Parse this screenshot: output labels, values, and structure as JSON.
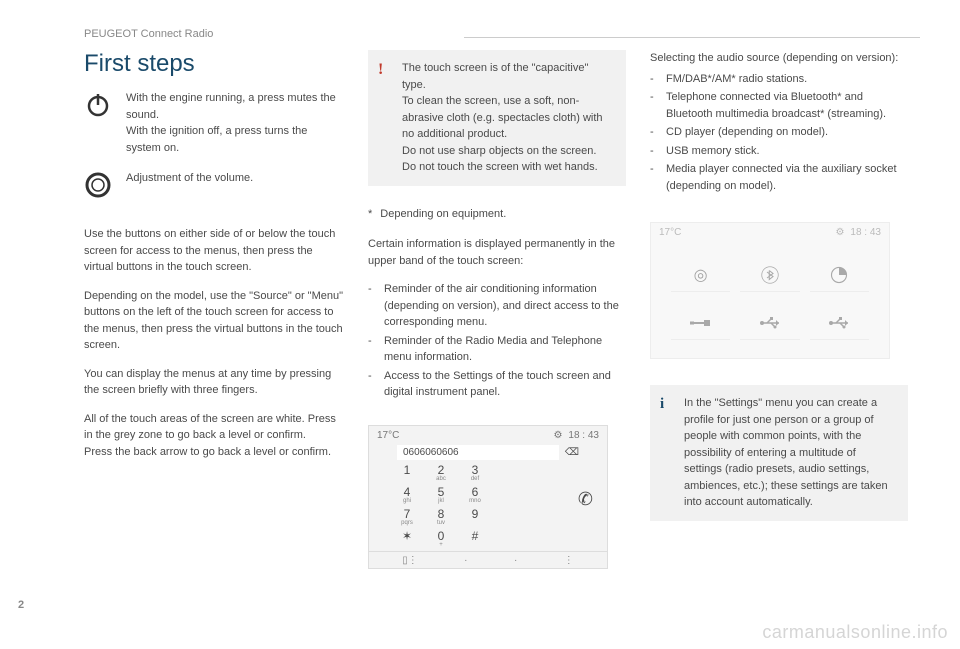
{
  "page_number": "2",
  "watermark": "carmanualsonline.info",
  "header": {
    "section": "PEUGEOT Connect Radio"
  },
  "col1": {
    "title": "First steps",
    "power_text": "With the engine running, a press mutes the sound.\nWith the ignition off, a press turns the system on.",
    "volume_text": "Adjustment of the volume.",
    "p1": "Use the buttons on either side of or below the touch screen for access to the menus, then press the virtual buttons in the touch screen.",
    "p2": "Depending on the model, use the \"Source\" or \"Menu\" buttons on the left of the touch screen for access to the menus, then press the virtual buttons in the touch screen.",
    "p3": "You can display the menus at any time by pressing the screen briefly with three fingers.",
    "p4": "All of the touch areas of the screen are white. Press in the grey zone to go back a level or confirm.\nPress the back arrow to go back a level or confirm."
  },
  "col2": {
    "warning": "The touch screen is of the \"capacitive\" type.\nTo clean the screen, use a soft, non-abrasive cloth (e.g. spectacles cloth) with no additional product.\nDo not use sharp objects on the screen.\nDo not touch the screen with wet hands.",
    "footnote_star": "*",
    "footnote": "Depending on equipment.",
    "p1": "Certain information is displayed permanently in the upper band of the touch screen:",
    "bullets": [
      "Reminder of the air conditioning information (depending on version), and direct access to the corresponding menu.",
      "Reminder of the Radio Media and Telephone menu information.",
      "Access to the Settings of the touch screen and digital instrument panel."
    ],
    "screen": {
      "temp": "17°C",
      "time": "18 : 43",
      "dialed": "0606060606",
      "keys": [
        {
          "d": "1",
          "l": ""
        },
        {
          "d": "2",
          "l": "abc"
        },
        {
          "d": "3",
          "l": "def"
        },
        {
          "d": "4",
          "l": "ghi"
        },
        {
          "d": "5",
          "l": "jkl"
        },
        {
          "d": "6",
          "l": "mno"
        },
        {
          "d": "7",
          "l": "pqrs"
        },
        {
          "d": "8",
          "l": "tuv"
        },
        {
          "d": "9",
          "l": ""
        },
        {
          "d": "✶",
          "l": ""
        },
        {
          "d": "0",
          "l": "+"
        },
        {
          "d": "#",
          "l": ""
        }
      ]
    }
  },
  "col3": {
    "p1": "Selecting the audio source (depending on version):",
    "bullets": [
      "FM/DAB*/AM* radio stations.",
      "Telephone connected via Bluetooth* and Bluetooth multimedia broadcast* (streaming).",
      "CD player (depending on model).",
      "USB memory stick.",
      "Media player connected via the auxiliary socket (depending on model)."
    ],
    "screen": {
      "temp": "17°C",
      "time": "18 : 43"
    },
    "info": "In the \"Settings\" menu you can create a profile for just one person or a group of people with common points, with the possibility of entering a multitude of settings (radio presets, audio settings, ambiences, etc.); these settings are taken into account automatically."
  }
}
